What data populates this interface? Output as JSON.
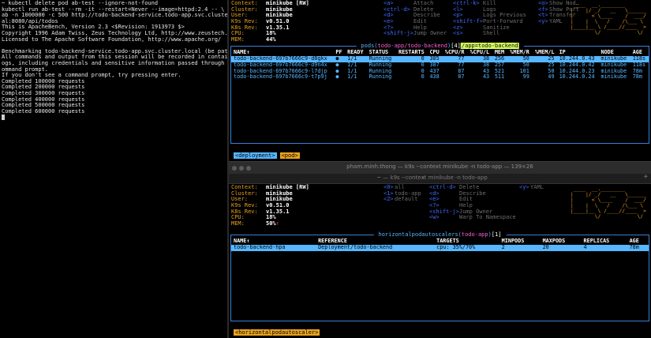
{
  "terminal": {
    "lines": [
      "~ kubectl delete pod ab-test --ignore-not-found",
      "kubectl run ab-test --rm -it --restart=Never --image=httpd:2.4 -- \\",
      "ab -n 1000000 -c 500 http://todo-backend-service.todo-app.svc.cluster.loc",
      "al:8080/api/todos",
      "This is ApacheBench, Version 2.3 <$Revision: 1913973 $>",
      "Copyright 1996 Adam Twiss, Zeus Technology Ltd, http://www.zeustech.net/",
      "Licensed to The Apache Software Foundation, http://www.apache.org/",
      "",
      "Benchmarking todo-backend-service.todo-app.svc.cluster.local (be patient)",
      "All commands and output from this session will be recorded in container l",
      "ogs, including credentials and sensitive information passed through the c",
      "ommand prompt.",
      "If you don't see a command prompt, try pressing enter.",
      "Completed 100000 requests",
      "Completed 200000 requests",
      "Completed 300000 requests",
      "Completed 400000 requests",
      "Completed 500000 requests",
      "Completed 600000 requests"
    ]
  },
  "k9s_top": {
    "info": [
      {
        "label": "Context:",
        "value": "minikube [RW]"
      },
      {
        "label": "Cluster:",
        "value": "minikube"
      },
      {
        "label": "User:",
        "value": "minikube"
      },
      {
        "label": "K9s Rev:",
        "value": "v0.51.0"
      },
      {
        "label": "K8s Rev:",
        "value": "v1.35.1"
      },
      {
        "label": "CPU:",
        "value": "18%"
      },
      {
        "label": "MEM:",
        "value": "44%"
      }
    ],
    "shortcuts_col1": [
      {
        "key": "<a>",
        "desc": "Attach"
      },
      {
        "key": "<ctrl-d>",
        "desc": "Delete"
      },
      {
        "key": "<d>",
        "desc": "Describe"
      },
      {
        "key": "<e>",
        "desc": "Edit"
      },
      {
        "key": "<?>",
        "desc": "Help"
      },
      {
        "key": "<shift-j>",
        "desc": "Jump Owner"
      }
    ],
    "shortcuts_col2": [
      {
        "key": "<ctrl-k>",
        "desc": "Kill"
      },
      {
        "key": "<l>",
        "desc": "Logs"
      },
      {
        "key": "<p>",
        "desc": "Logs Previous"
      },
      {
        "key": "<shift-f>",
        "desc": "Port-Forward"
      },
      {
        "key": "<z>",
        "desc": "Sanitize"
      },
      {
        "key": "<s>",
        "desc": "Shell"
      }
    ],
    "shortcuts_col3": [
      {
        "key": "<o>",
        "desc": "Show Nod…"
      },
      {
        "key": "<f>",
        "desc": "Show Port"
      },
      {
        "key": "<t>",
        "desc": "Transfer"
      },
      {
        "key": "<y>",
        "desc": "YAML"
      }
    ],
    "frame_title": {
      "prefix": " pods(",
      "ns": "todo-app/todo-backend",
      "count": "[4]",
      "filter": "/app=todo-backend",
      "suffix": " "
    },
    "columns": [
      "NAME↑",
      "PF",
      "READY",
      "STATUS",
      "RESTARTS",
      "CPU",
      "%CPU/R",
      "%CPU/L",
      "MEM",
      "%MEM/R",
      "%MEM/L",
      "IP",
      "NODE",
      "AGE"
    ],
    "rows": [
      [
        "todo-backend-697b7666c9-d8gkx",
        "●",
        "1/1",
        "Running",
        "0",
        "385",
        "77",
        "38",
        "256",
        "50",
        "25",
        "10.244.0.43",
        "minikube",
        "118s"
      ],
      [
        "todo-backend-697b7666c9-d9n4x",
        "●",
        "1/1",
        "Running",
        "0",
        "387",
        "77",
        "38",
        "257",
        "50",
        "25",
        "10.244.0.42",
        "minikube",
        "118s"
      ],
      [
        "todo-backend-697b7666c9-l7djp",
        "●",
        "1/1",
        "Running",
        "0",
        "437",
        "87",
        "43",
        "521",
        "101",
        "50",
        "10.244.0.23",
        "minikube",
        "78m"
      ],
      [
        "todo-backend-697b7666c9-t7p9j",
        "●",
        "1/1",
        "Running",
        "0",
        "438",
        "87",
        "43",
        "511",
        "99",
        "49",
        "10.244.0.24",
        "minikube",
        "78m"
      ]
    ],
    "crumbs": [
      "<deployment>",
      "<pod>"
    ]
  },
  "window_title": "pham.minh.thong — k9s --context minikube -n todo-app — 139×26",
  "tab_title": "~ — k9s --context minikube -n todo-app",
  "k9s_bottom": {
    "info": [
      {
        "label": "Context:",
        "value": "minikube [RW]"
      },
      {
        "label": "Cluster:",
        "value": "minikube"
      },
      {
        "label": "User:",
        "value": "minikube"
      },
      {
        "label": "K9s Rev:",
        "value": "v0.51.0"
      },
      {
        "label": "K8s Rev:",
        "value": "v1.35.1"
      },
      {
        "label": "CPU:",
        "value": "18%"
      },
      {
        "label": "MEM:",
        "value": "50%"
      }
    ],
    "mem_trend": "↑",
    "shortcuts_col1": [
      {
        "key": "<0>",
        "desc": "all"
      },
      {
        "key": "<1>",
        "desc": "todo-app"
      },
      {
        "key": "<2>",
        "desc": "default"
      }
    ],
    "shortcuts_col2": [
      {
        "key": "<ctrl-d>",
        "desc": "Delete"
      },
      {
        "key": "<d>",
        "desc": "Describe"
      },
      {
        "key": "<e>",
        "desc": "Edit"
      },
      {
        "key": "<?>",
        "desc": "Help"
      },
      {
        "key": "<shift-j>",
        "desc": "Jump Owner"
      },
      {
        "key": "<w>",
        "desc": "Warp To Namespace"
      }
    ],
    "shortcuts_col3": [
      {
        "key": "<y>",
        "desc": "YAML"
      }
    ],
    "frame_title": {
      "prefix": " horizontalpodautoscalers(",
      "ns": "todo-app",
      "count": "[1]",
      "suffix": " "
    },
    "columns": [
      "NAME↑",
      "REFERENCE",
      "TARGETS",
      "MINPODS",
      "MAXPODS",
      "REPLICAS",
      "AGE"
    ],
    "rows": [
      [
        "todo-backend-hpa",
        "Deployment/todo-backend",
        "cpu: 35%/70%",
        "2",
        "20",
        "4",
        "78m"
      ]
    ],
    "crumbs": [
      "<horizontalpodautoscaler>"
    ]
  },
  "colors": {
    "accent": "#e8a21f",
    "table": "#56b6ff",
    "key": "#3f6bff",
    "filter": "#d6ff5f"
  }
}
